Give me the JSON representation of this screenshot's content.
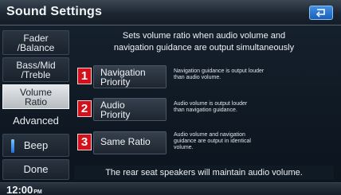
{
  "title": "Sound Settings",
  "sidebar": {
    "items": [
      {
        "label": "Fader\n/Balance"
      },
      {
        "label": "Bass/Mid\n/Treble"
      },
      {
        "label": "Volume\nRatio"
      },
      {
        "label": "Advanced"
      },
      {
        "label": "Beep"
      },
      {
        "label": "Done"
      }
    ]
  },
  "main": {
    "description_line1": "Sets volume ratio when audio volume and",
    "description_line2": "navigation guidance are output simultaneously",
    "options": [
      {
        "number": "1",
        "label_line1": "Navigation",
        "label_line2": "Priority",
        "desc_line1": "Navigation guidance is output louder",
        "desc_line2": "than audio volume."
      },
      {
        "number": "2",
        "label_line1": "Audio",
        "label_line2": "Priority",
        "desc_line1": "Audio volume is output louder",
        "desc_line2": "than navigation guidance."
      },
      {
        "number": "3",
        "label_line1": "Same Ratio",
        "label_line2": "",
        "desc_line1": "Audio volume and navigation",
        "desc_line2": "guidance are output in identical",
        "desc_line3": "volume."
      }
    ],
    "footer_note": "The rear seat speakers will maintain audio volume."
  },
  "status": {
    "time": "12:00",
    "ampm": "PM"
  },
  "icons": {
    "back": "return-arrow-icon"
  },
  "colors": {
    "accent_red": "#d4111a",
    "back_button_blue": "#2f7fd9",
    "beep_indicator": "#3d92f0"
  }
}
